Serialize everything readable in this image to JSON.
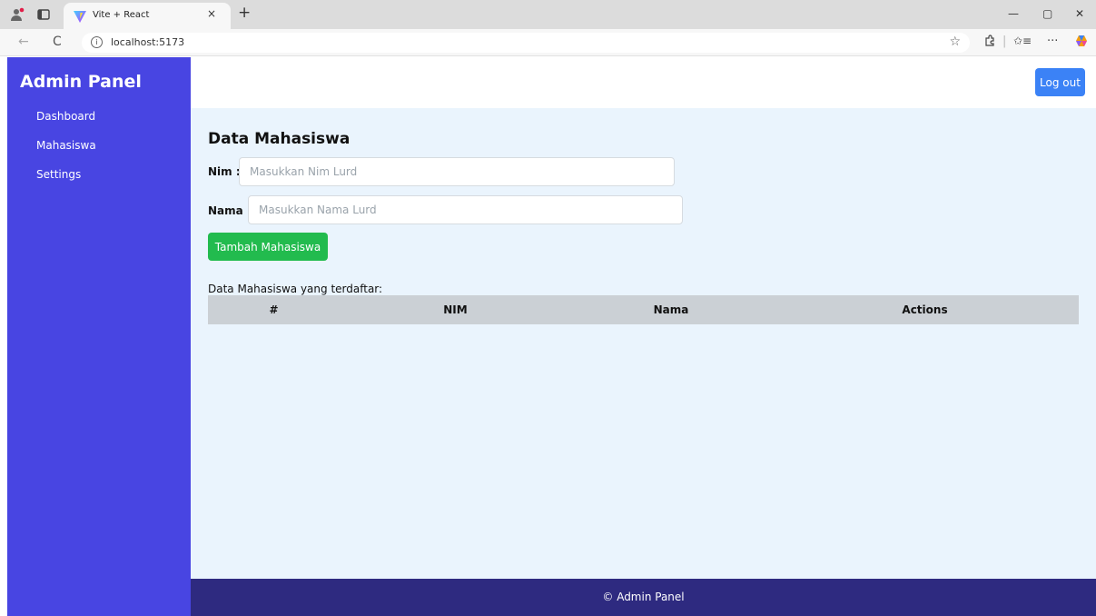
{
  "browser": {
    "tab_title": "Vite + React",
    "tab_close": "×",
    "new_tab": "+",
    "url": "localhost:5173",
    "info": "i",
    "star": "☆",
    "back": "←",
    "reload": "C",
    "minimize": "—",
    "maximize": "▢",
    "close": "✕",
    "more": "···",
    "favorites": "✩≡"
  },
  "sidebar": {
    "brand": "Admin Panel",
    "items": [
      {
        "label": "Dashboard"
      },
      {
        "label": "Mahasiswa"
      },
      {
        "label": "Settings"
      }
    ]
  },
  "topbar": {
    "logout_label": "Log out"
  },
  "main": {
    "title": "Data Mahasiswa",
    "nim_label": "Nim :",
    "nim_placeholder": "Masukkan Nim Lurd",
    "nim_value": "",
    "nama_label": "Nama :",
    "nama_placeholder": "Masukkan Nama Lurd",
    "nama_value": "",
    "add_button": "Tambah Mahasiswa",
    "list_caption": "Data Mahasiswa yang terdaftar:",
    "table": {
      "columns": [
        "#",
        "NIM",
        "Nama",
        "Actions"
      ],
      "rows": []
    }
  },
  "footer": {
    "text": "© Admin Panel"
  },
  "colors": {
    "sidebar": "#4845e2",
    "footer": "#2e2a80",
    "main_bg": "#eaf4fd",
    "primary": "#3b82f6",
    "success": "#22bb4e",
    "table_header": "#cbd0d5"
  }
}
